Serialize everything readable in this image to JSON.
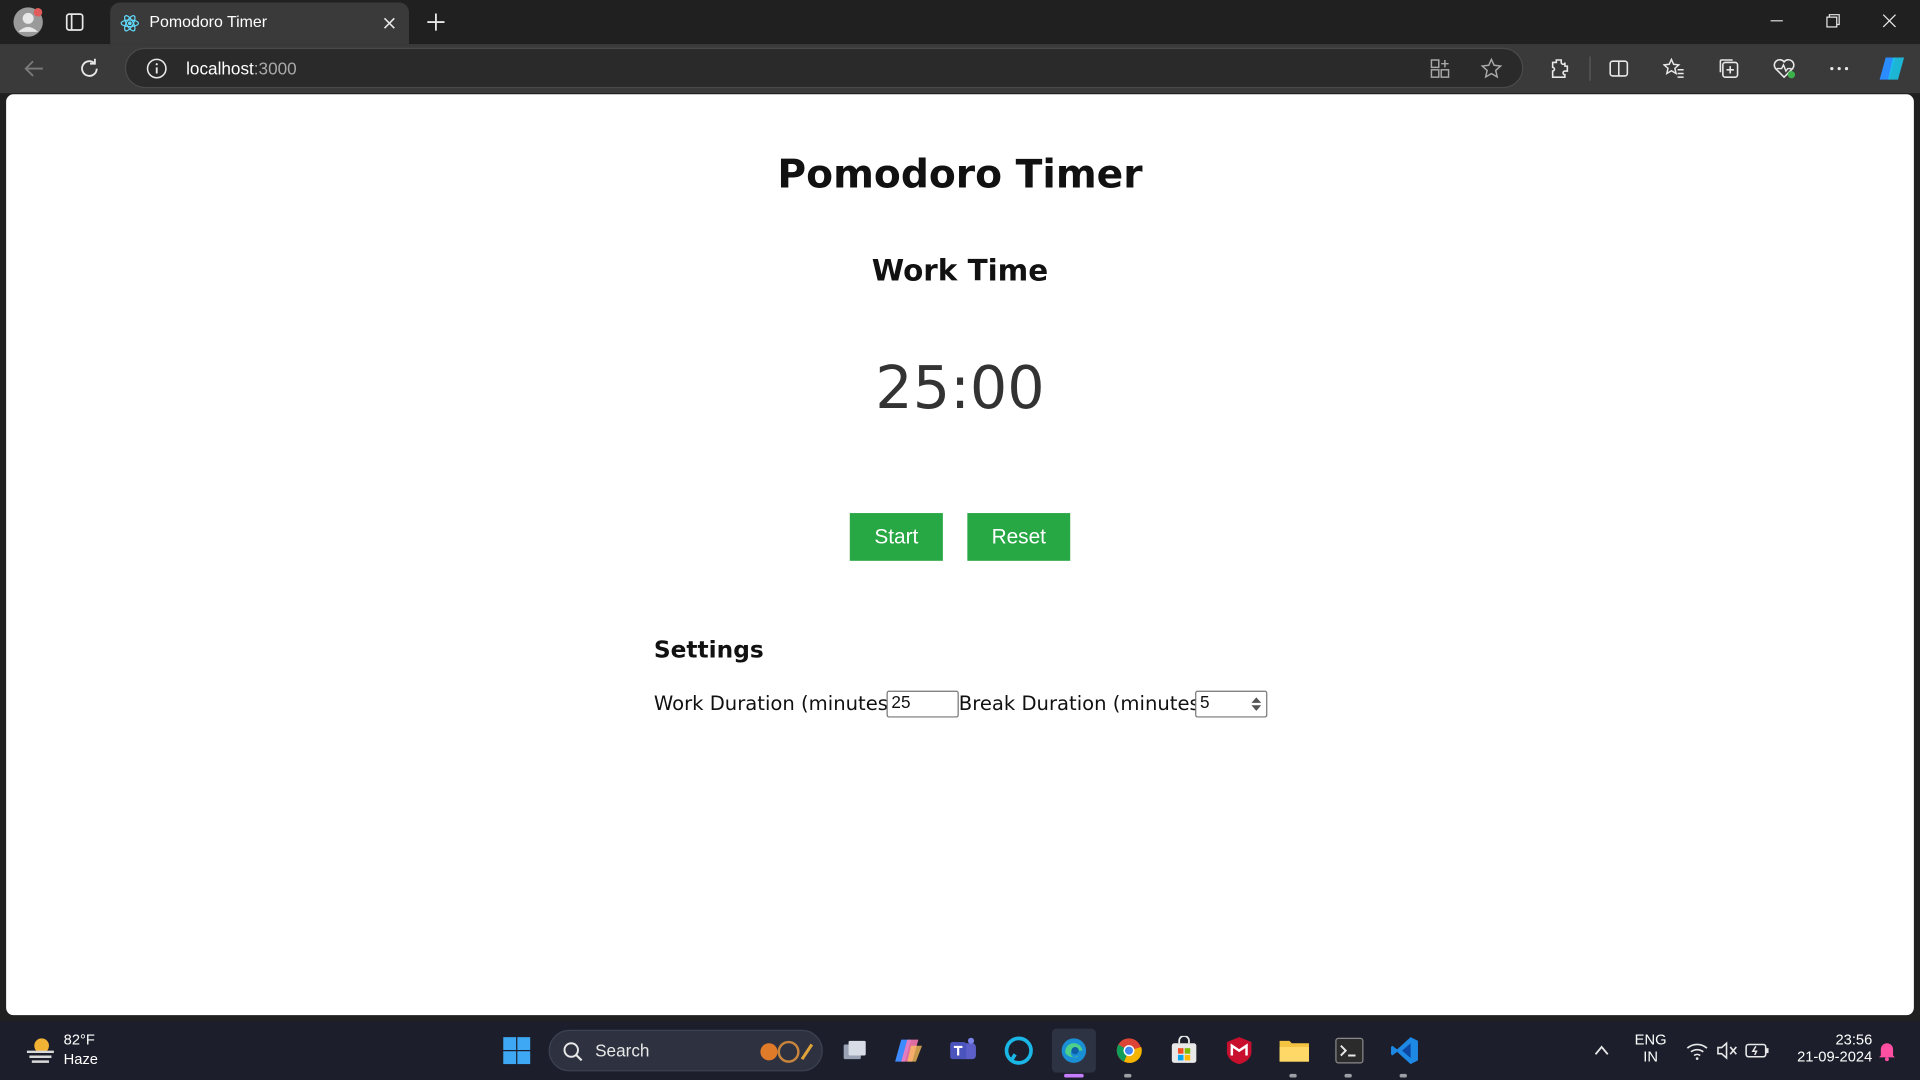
{
  "browser": {
    "tab_title": "Pomodoro Timer",
    "url_host": "localhost",
    "url_port": ":3000",
    "icons": [
      "profile-icon",
      "tab-actions-icon",
      "react-favicon",
      "close-icon",
      "new-tab-icon",
      "minimize-icon",
      "restore-icon",
      "window-close-icon",
      "back-icon",
      "refresh-icon",
      "site-info-icon",
      "app-available-icon",
      "favorite-star-icon",
      "extensions-icon",
      "split-screen-icon",
      "favorites-icon",
      "collections-icon",
      "browser-essentials-icon",
      "more-icon",
      "copilot-icon"
    ]
  },
  "app": {
    "title": "Pomodoro Timer",
    "mode_label": "Work Time",
    "time_display": "25:00",
    "start_label": "Start",
    "reset_label": "Reset",
    "settings_title": "Settings",
    "work_label": "Work Duration (minutes):",
    "work_value": "25",
    "break_label": "Break Duration (minutes):",
    "break_value": "5",
    "accent_color": "#28a745"
  },
  "taskbar": {
    "weather_temp": "82°F",
    "weather_condition": "Haze",
    "search_placeholder": "Search",
    "language_line1": "ENG",
    "language_line2": "IN",
    "time": "23:56",
    "date": "21-09-2024"
  }
}
